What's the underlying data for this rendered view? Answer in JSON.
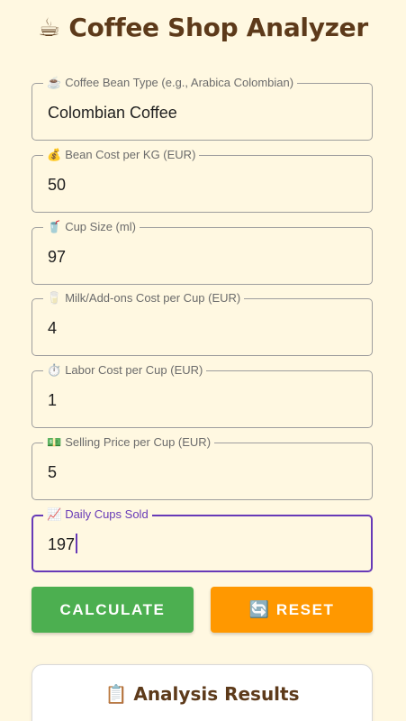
{
  "header": {
    "icon": "☕",
    "title": "Coffee Shop Analyzer"
  },
  "fields": [
    {
      "icon": "☕",
      "label": "Coffee Bean Type (e.g., Arabica Colombian)",
      "value": "Colombian Coffee"
    },
    {
      "icon": "💰",
      "label": "Bean Cost per KG (EUR)",
      "value": "50"
    },
    {
      "icon": "🥤",
      "label": "Cup Size (ml)",
      "value": "97"
    },
    {
      "icon": "🥛",
      "label": "Milk/Add-ons Cost per Cup (EUR)",
      "value": "4"
    },
    {
      "icon": "⏱️",
      "label": "Labor Cost per Cup (EUR)",
      "value": "1"
    },
    {
      "icon": "💵",
      "label": "Selling Price per Cup (EUR)",
      "value": "5"
    },
    {
      "icon": "📈",
      "label": "Daily Cups Sold",
      "value": "197"
    }
  ],
  "buttons": {
    "calculate_label": "CALCULATE",
    "reset_icon": "🔄",
    "reset_label": "RESET"
  },
  "results": {
    "icon": "📋",
    "title": "Analysis Results"
  },
  "colors": {
    "background": "#fff8e1",
    "title": "#5d3a1a",
    "focus": "#673ab7",
    "calculate": "#4caf50",
    "reset": "#ff9800"
  }
}
